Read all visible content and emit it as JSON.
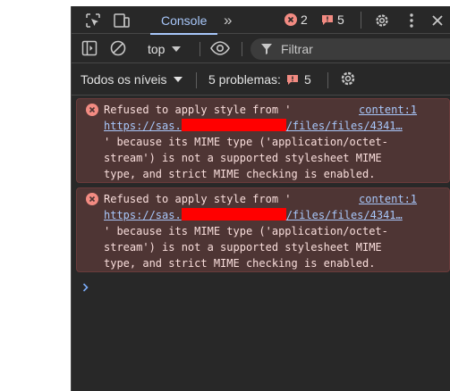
{
  "tabs": {
    "console_label": "Console",
    "more_tabs": "»",
    "error_count": "2",
    "warning_count": "5"
  },
  "toolbar": {
    "context": "top",
    "filter_placeholder": "Filtrar"
  },
  "levels": {
    "label": "Todos os níveis",
    "problems_label": "5 problemas:",
    "problems_count": "5"
  },
  "messages": [
    {
      "line1": "Refused to apply style from '",
      "source": "content:1",
      "url_prefix": "https://sas.",
      "url_suffix": "/files/files/4341…",
      "line3": "' because its MIME type ('application/octet-",
      "line4": "stream') is not a supported stylesheet MIME",
      "line5": "type, and strict MIME checking is enabled."
    },
    {
      "line1": "Refused to apply style from '",
      "source": "content:1",
      "url_prefix": "https://sas.",
      "url_suffix": "/files/files/4341…",
      "line3": "' because its MIME type ('application/octet-",
      "line4": "stream') is not a supported stylesheet MIME",
      "line5": "type, and strict MIME checking is enabled."
    }
  ],
  "colors": {
    "accent": "#a8c7fa",
    "error_icon": "#f28b82",
    "error_bg": "#4e3534",
    "redaction": "#ff0000"
  },
  "icons": [
    "inspect-icon",
    "device-toolbar-icon",
    "error-icon",
    "warning-icon",
    "gear-icon",
    "kebab-menu-icon",
    "close-icon",
    "sidebar-icon",
    "clear-console-icon",
    "eye-icon",
    "filter-icon",
    "prompt-chevron-icon"
  ]
}
